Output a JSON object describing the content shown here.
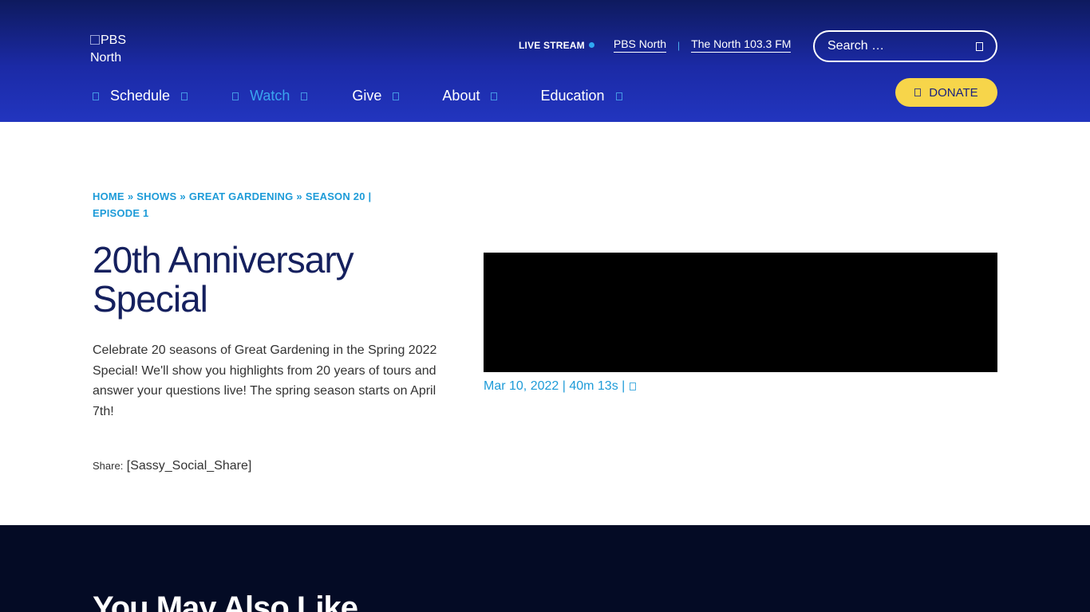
{
  "header": {
    "logo_alt": "PBS North",
    "live_stream_label": "LIVE STREAM",
    "top_links": [
      "PBS North",
      "The North 103.3 FM"
    ],
    "search_placeholder": "Search …",
    "nav": [
      {
        "label": "Schedule",
        "active": false
      },
      {
        "label": "Watch",
        "active": true
      },
      {
        "label": "Give",
        "active": false
      },
      {
        "label": "About",
        "active": false
      },
      {
        "label": "Education",
        "active": false
      }
    ],
    "donate_label": "DONATE"
  },
  "breadcrumb": [
    "HOME",
    "SHOWS",
    "GREAT GARDENING",
    "SEASON 20 | EPISODE 1"
  ],
  "breadcrumb_separator": "»",
  "episode": {
    "title": "20th Anniversary Special",
    "description": "Celebrate 20 seasons of Great Gardening in the Spring 2022 Special! We'll show you highlights from 20 years of tours and answer your questions live! The spring season starts on April 7th!",
    "meta": "Mar 10, 2022 | 40m 13s |"
  },
  "share": {
    "label": "Share:",
    "shortcode": "[Sassy_Social_Share]"
  },
  "related": {
    "title": "You May Also Like"
  },
  "colors": {
    "header_dark": "#0e1a5e",
    "header_light": "#2235bf",
    "accent_blue": "#1d9bd8",
    "title_navy": "#15205e",
    "donate_yellow": "#f7d54a",
    "footer_bg": "#040b25"
  }
}
